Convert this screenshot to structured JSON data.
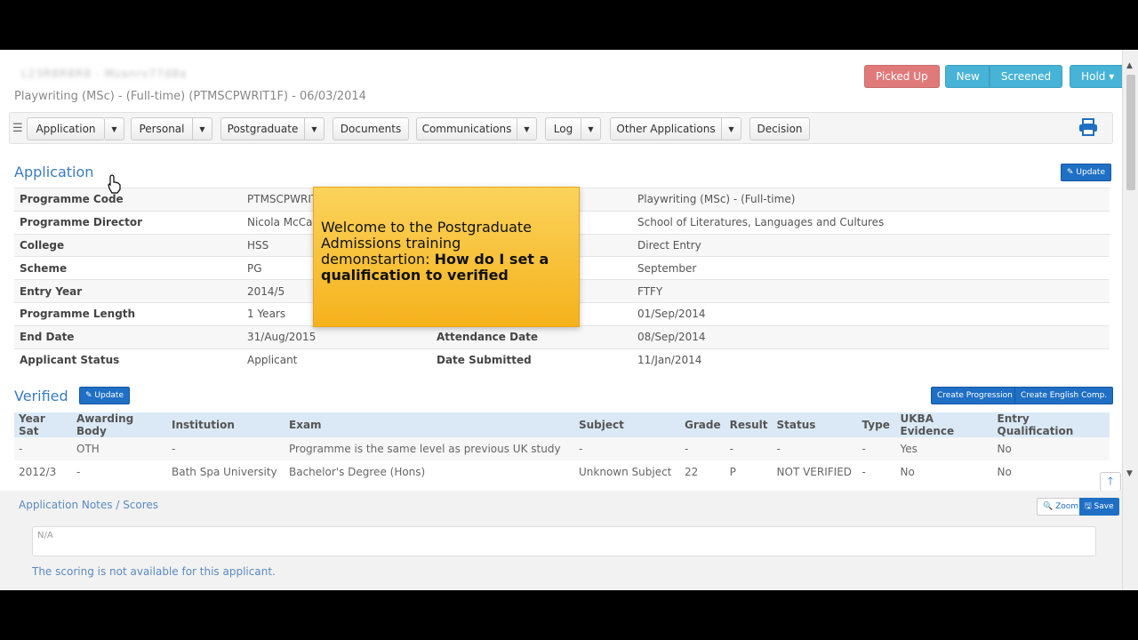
{
  "header": {
    "blurred_name": "L23R8R8R8 - Mzanrv77d8a",
    "subtitle": "Playwriting (MSc) - (Full-time) (PTMSCPWRIT1F) - 06/03/2014",
    "actions": {
      "picked_up": "Picked Up",
      "new": "New",
      "screened": "Screened",
      "hold": "Hold ▾"
    }
  },
  "nav": {
    "application": "Application",
    "personal": "Personal",
    "postgraduate": "Postgraduate",
    "documents": "Documents",
    "communications": "Communications",
    "log": "Log",
    "other_applications": "Other Applications",
    "decision": "Decision",
    "caret": "▼"
  },
  "application": {
    "title": "Application",
    "update_label": "✎ Update",
    "rows": [
      {
        "l1": "Programme Code",
        "v1": "PTMSCPWRIT",
        "l2": "",
        "v2": "Playwriting (MSc) - (Full-time)"
      },
      {
        "l1": "Programme Director",
        "v1": "Nicola McCart",
        "l2": "",
        "v2": "School of Literatures, Languages and Cultures"
      },
      {
        "l1": "College",
        "v1": "HSS",
        "l2": "",
        "v2": "Direct Entry"
      },
      {
        "l1": "Scheme",
        "v1": "PG",
        "l2": "",
        "v2": "September"
      },
      {
        "l1": "Entry Year",
        "v1": "2014/5",
        "l2": "",
        "v2": "FTFY"
      },
      {
        "l1": "Programme Length",
        "v1": "1 Years",
        "l2": "",
        "v2": "01/Sep/2014"
      },
      {
        "l1": "End Date",
        "v1": "31/Aug/2015",
        "l2": "Attendance Date",
        "v2": "08/Sep/2014"
      },
      {
        "l1": "Applicant Status",
        "v1": "Applicant",
        "l2": "Date Submitted",
        "v2": "11/Jan/2014"
      }
    ]
  },
  "verified": {
    "title": "Verified",
    "update_label": "✎ Update",
    "create_progression": "Create Progression",
    "create_english": "Create English Comp.",
    "columns": [
      "Year Sat",
      "Awarding Body",
      "Institution",
      "Exam",
      "Subject",
      "Grade",
      "Result",
      "Status",
      "Type",
      "UKBA Evidence",
      "Entry Qualification"
    ],
    "rows": [
      [
        "-",
        "OTH",
        "-",
        "Programme is the same level as previous UK study",
        "-",
        "-",
        "-",
        "-",
        "-",
        "Yes",
        "No"
      ],
      [
        "2012/3",
        "-",
        "Bath Spa University",
        "Bachelor's Degree (Hons)",
        "Unknown Subject",
        "22",
        "P",
        "NOT VERIFIED",
        "-",
        "No",
        "No"
      ]
    ]
  },
  "notes": {
    "title": "Application Notes / Scores",
    "zoom": "🔍 Zoom",
    "save": "🖫 Save",
    "value": "N/A",
    "scoring": "The scoring is not available for this applicant."
  },
  "overlay": {
    "line1": "Welcome to the Postgraduate Admissions training demonstartion: ",
    "line2": "How do I set a qualification to verified"
  },
  "colors": {
    "accent": "#3a7bbf",
    "primary_button": "#1f6fc4",
    "picked_up": "#e07a7a",
    "status_blue": "#47b3d6",
    "overlay": "#f9c443"
  }
}
